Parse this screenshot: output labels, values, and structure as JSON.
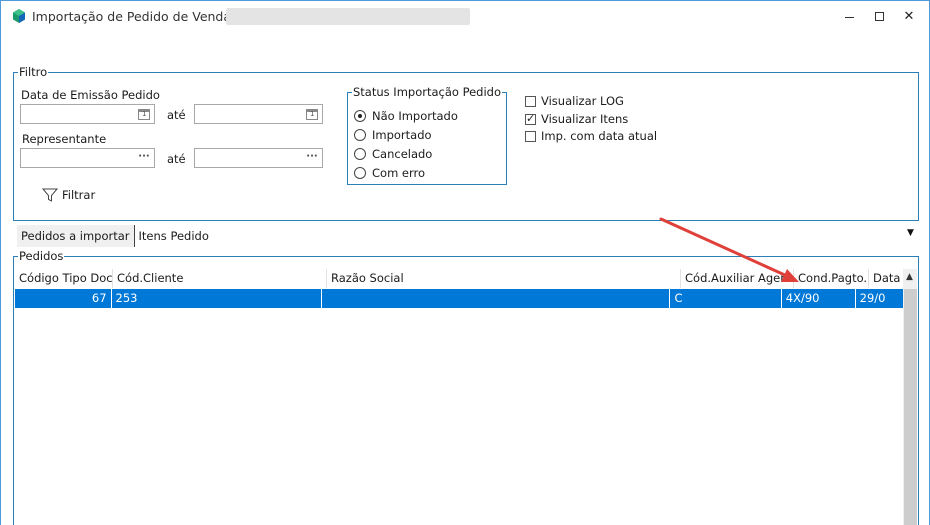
{
  "window": {
    "title": "Importação de Pedido de Venda",
    "controls": {
      "minimize": "—",
      "maximize": "☐",
      "close": "✕"
    }
  },
  "filtro": {
    "legend": "Filtro",
    "data_emissao_label": "Data de Emissão Pedido",
    "ate_1": "até",
    "representante_label": "Representante",
    "ate_2": "até",
    "data_inicio_value": "",
    "data_fim_value": "",
    "representante_inicio_value": "",
    "representante_fim_value": "",
    "browse_glyph": "···",
    "filtrar_label": "Filtrar",
    "status": {
      "legend": "Status Importação Pedido",
      "options": [
        {
          "label": "Não Importado",
          "selected": true
        },
        {
          "label": "Importado",
          "selected": false
        },
        {
          "label": "Cancelado",
          "selected": false
        },
        {
          "label": "Com erro",
          "selected": false
        }
      ]
    },
    "checks": [
      {
        "label": "Visualizar LOG",
        "checked": false
      },
      {
        "label": "Visualizar Itens",
        "checked": true
      },
      {
        "label": "Imp. com data atual",
        "checked": false
      }
    ]
  },
  "tabs": [
    {
      "label": "Pedidos a importar",
      "active": true
    },
    {
      "label": "Itens Pedido",
      "active": false
    }
  ],
  "pedidos": {
    "legend": "Pedidos",
    "columns": [
      "Código Tipo Doc.",
      "Cód.Cliente",
      "Razão Social",
      "Cód.Auxiliar Agen",
      "Cond.Pagto.",
      "Data"
    ],
    "rows": [
      [
        "67",
        "253",
        "",
        "C",
        "4X/90",
        "29/0"
      ]
    ]
  },
  "colors": {
    "window_border": "#4f9ad8",
    "group_border": "#2b7fb6",
    "selected_row": "#0078d7",
    "annotation_arrow": "#e0403a"
  }
}
